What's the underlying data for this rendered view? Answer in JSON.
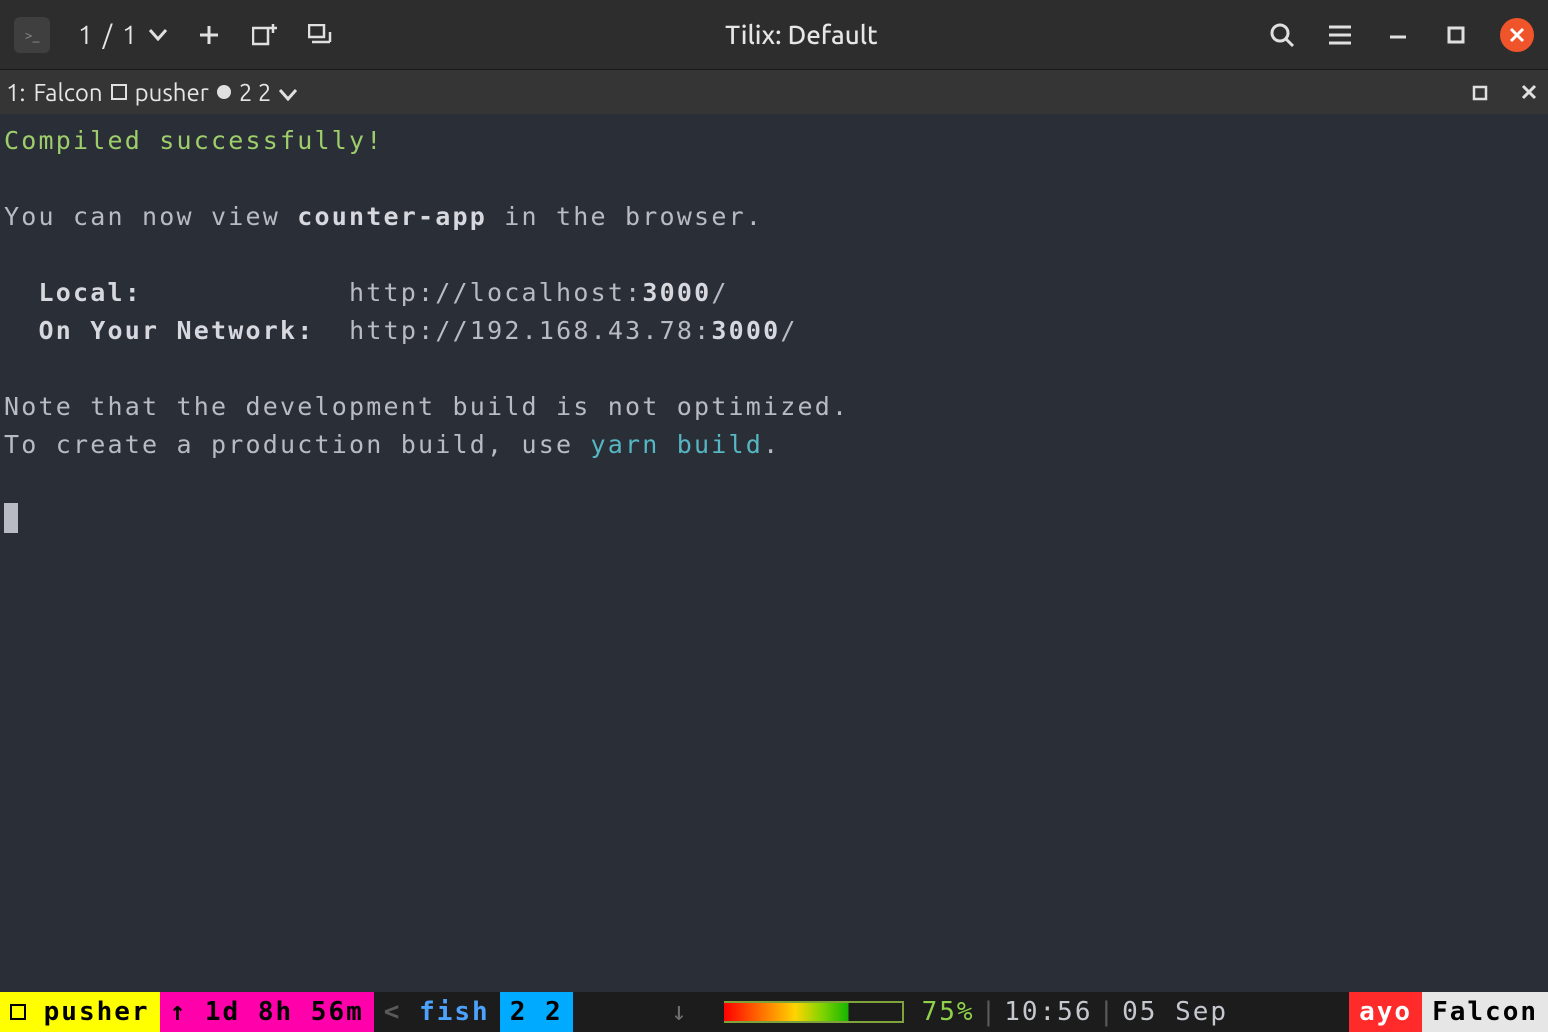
{
  "window": {
    "title": "Tilix: Default",
    "pane_indicator": "1 / 1"
  },
  "tab": {
    "index": "1:",
    "host": "Falcon",
    "session": "pusher",
    "window_pane": "2 2"
  },
  "terminal": {
    "compiled": "Compiled successfully!",
    "view_prefix": "You can now view ",
    "app_name": "counter-app",
    "view_suffix": " in the browser.",
    "local_label": "Local:",
    "local_url_pre": "http://localhost:",
    "local_port": "3000",
    "local_url_post": "/",
    "network_label": "On Your Network:",
    "network_url_pre": "http://192.168.43.78:",
    "network_port": "3000",
    "network_url_post": "/",
    "note_line": "Note that the development build is not optimized.",
    "prod_prefix": "To create a production build, use ",
    "prod_cmd": "yarn build",
    "prod_suffix": "."
  },
  "status": {
    "session": "pusher",
    "uptime": "1d 8h 56m",
    "shell": "fish",
    "window_pane": "2 2",
    "battery_pct": "75%",
    "time": "10:56",
    "date": "05 Sep",
    "user": "ayo",
    "host": "Falcon"
  }
}
